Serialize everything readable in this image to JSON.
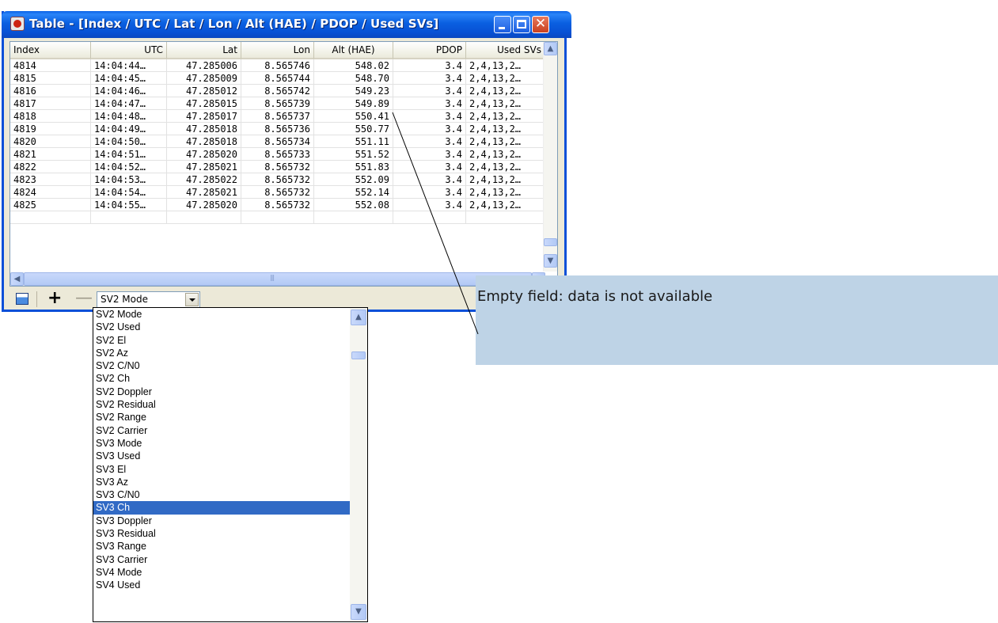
{
  "window": {
    "title": "Table - [Index / UTC / Lat / Lon / Alt (HAE) / PDOP / Used SVs]"
  },
  "table": {
    "columns": [
      "Index",
      "UTC",
      "Lat",
      "Lon",
      "Alt (HAE)",
      "PDOP",
      "Used SVs"
    ],
    "rows": [
      [
        "4814",
        "14:04:44…",
        "47.285006",
        "8.565746",
        "548.02",
        "3.4",
        "2,4,13,2…"
      ],
      [
        "4815",
        "14:04:45…",
        "47.285009",
        "8.565744",
        "548.70",
        "3.4",
        "2,4,13,2…"
      ],
      [
        "4816",
        "14:04:46…",
        "47.285012",
        "8.565742",
        "549.23",
        "3.4",
        "2,4,13,2…"
      ],
      [
        "4817",
        "14:04:47…",
        "47.285015",
        "8.565739",
        "549.89",
        "3.4",
        "2,4,13,2…"
      ],
      [
        "4818",
        "14:04:48…",
        "47.285017",
        "8.565737",
        "550.41",
        "3.4",
        "2,4,13,2…"
      ],
      [
        "4819",
        "14:04:49…",
        "47.285018",
        "8.565736",
        "550.77",
        "3.4",
        "2,4,13,2…"
      ],
      [
        "4820",
        "14:04:50…",
        "47.285018",
        "8.565734",
        "551.11",
        "3.4",
        "2,4,13,2…"
      ],
      [
        "4821",
        "14:04:51…",
        "47.285020",
        "8.565733",
        "551.52",
        "3.4",
        "2,4,13,2…"
      ],
      [
        "4822",
        "14:04:52…",
        "47.285021",
        "8.565732",
        "551.83",
        "3.4",
        "2,4,13,2…"
      ],
      [
        "4823",
        "14:04:53…",
        "47.285022",
        "8.565732",
        "552.09",
        "3.4",
        "2,4,13,2…"
      ],
      [
        "4824",
        "14:04:54…",
        "47.285021",
        "8.565732",
        "552.14",
        "3.4",
        "2,4,13,2…"
      ],
      [
        "4825",
        "14:04:55…",
        "47.285020",
        "8.565732",
        "552.08",
        "3.4",
        "2,4,13,2…"
      ],
      [
        "",
        "",
        "",
        "",
        "",
        "",
        ""
      ]
    ]
  },
  "toolbar": {
    "combo_value": "SV2 Mode"
  },
  "dropdown": {
    "selected_index": 15,
    "options": [
      "SV2 Mode",
      "SV2 Used",
      "SV2 El",
      "SV2 Az",
      "SV2 C/N0",
      "SV2 Ch",
      "SV2 Doppler",
      "SV2 Residual",
      "SV2 Range",
      "SV2 Carrier",
      "SV3 Mode",
      "SV3 Used",
      "SV3 El",
      "SV3 Az",
      "SV3 C/N0",
      "SV3 Ch",
      "SV3 Doppler",
      "SV3 Residual",
      "SV3 Range",
      "SV3 Carrier",
      "SV4 Mode",
      "SV4 Used"
    ]
  },
  "callout": {
    "text": "Empty field: data is not available"
  },
  "colors": {
    "titlebar": "#0a5fe0",
    "selection": "#316ac5",
    "callout_bg": "#bed3e6"
  },
  "icons": [
    "app-icon",
    "minimize-icon",
    "maximize-icon",
    "close-icon",
    "table-view-icon",
    "add-icon",
    "remove-icon",
    "dropdown-arrow-icon"
  ]
}
